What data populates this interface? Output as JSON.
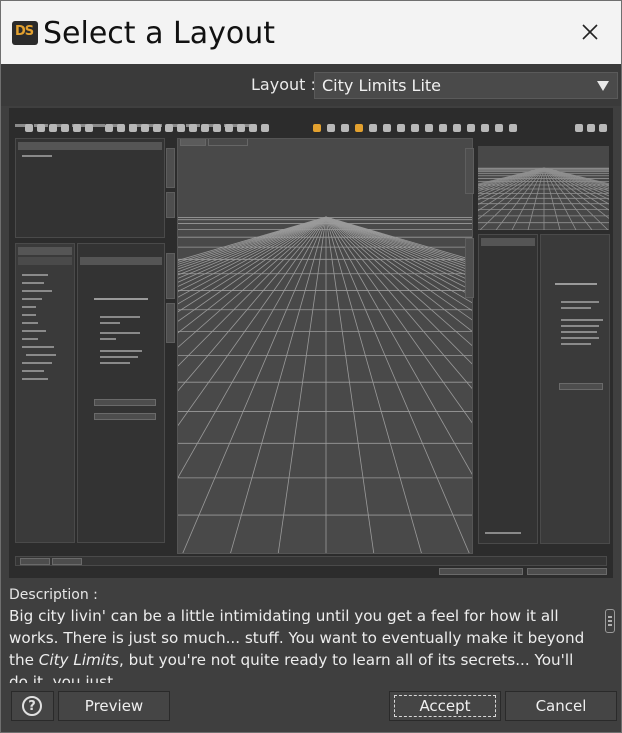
{
  "window": {
    "title": "Select a Layout",
    "app_icon_text": "DS",
    "icons": {
      "app": "daz-studio-app-icon",
      "close": "close-icon"
    }
  },
  "layout_selector": {
    "label": "Layout :",
    "selected": "City Limits Lite",
    "icon": "dropdown-arrow-icon"
  },
  "preview": {
    "description": "Screenshot preview of the City Limits Lite layout",
    "content_text_note": "Preview text is too small to read and is drawn as placeholder marks"
  },
  "description": {
    "label": "Description :",
    "text_before_city": "Big city livin' can be a little intimidating until you get a feel for how it all works. There is just so much... stuff. You want to eventually make it beyond the ",
    "city_limits": "City Limits",
    "text_after_city": ", but you're not quite ready to learn all of its secrets... You'll do it, you just"
  },
  "buttons": {
    "help": "?",
    "preview": "Preview",
    "accept": "Accept",
    "cancel": "Cancel"
  },
  "colors": {
    "accent": "#e3a12f",
    "window_bg": "#3f3f3f",
    "titlebar_bg": "#f3f3f3"
  }
}
